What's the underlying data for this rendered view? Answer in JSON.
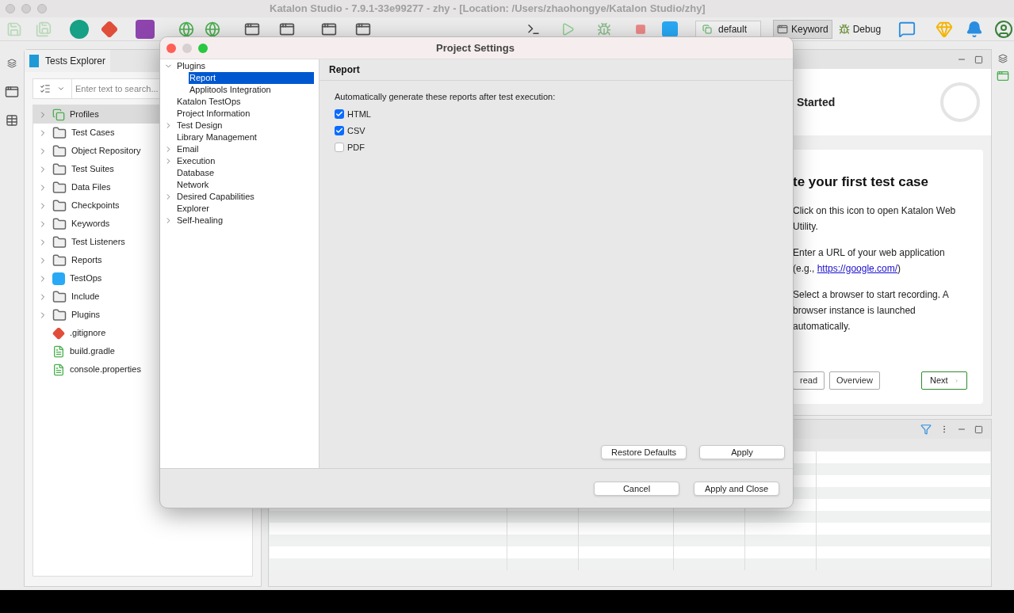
{
  "window": {
    "title": "Katalon Studio - 7.9.1-33e99277 - zhy - [Location: /Users/zhaohongye/Katalon Studio/zhy]"
  },
  "toolbar": {
    "profile": "default",
    "keyword_button": "Keyword",
    "debug_button": "Debug"
  },
  "explorer": {
    "tab": "Tests Explorer",
    "search_placeholder": "Enter text to search...",
    "items": [
      {
        "label": "Profiles",
        "kind": "profiles",
        "selected": true
      },
      {
        "label": "Test Cases",
        "kind": "folder",
        "selected": false
      },
      {
        "label": "Object Repository",
        "kind": "folder",
        "selected": false
      },
      {
        "label": "Test Suites",
        "kind": "folder",
        "selected": false
      },
      {
        "label": "Data Files",
        "kind": "folder",
        "selected": false
      },
      {
        "label": "Checkpoints",
        "kind": "folder",
        "selected": false
      },
      {
        "label": "Keywords",
        "kind": "folder",
        "selected": false
      },
      {
        "label": "Test Listeners",
        "kind": "folder",
        "selected": false
      },
      {
        "label": "Reports",
        "kind": "folder",
        "selected": false
      },
      {
        "label": "TestOps",
        "kind": "testops",
        "selected": false
      },
      {
        "label": "Include",
        "kind": "folder",
        "selected": false
      },
      {
        "label": "Plugins",
        "kind": "folder",
        "selected": false
      },
      {
        "label": ".gitignore",
        "kind": "git",
        "selected": false
      },
      {
        "label": "build.gradle",
        "kind": "file",
        "selected": false
      },
      {
        "label": "console.properties",
        "kind": "file",
        "selected": false
      }
    ]
  },
  "getting_started": {
    "title": "Started",
    "heading": "te your first test case",
    "paragraphs": [
      {
        "text": "Click on this icon  to open Katalon Web Utility."
      },
      {
        "text": "Enter a URL of your web application (e.g., ",
        "link": "https://google.com/",
        "after": ")"
      },
      {
        "text": "Select a browser to start recording. A browser instance is launched automatically."
      }
    ],
    "buttons": [
      "read",
      "Overview"
    ],
    "next_button": "Next"
  },
  "dialog": {
    "title": "Project Settings",
    "tree": [
      {
        "label": "Plugins",
        "expanded": true,
        "selected": false,
        "children": [
          {
            "label": "Report",
            "selected": true
          },
          {
            "label": "Applitools Integration",
            "selected": false
          }
        ]
      },
      {
        "label": "Katalon TestOps",
        "selected": false
      },
      {
        "label": "Project Information",
        "selected": false
      },
      {
        "label": "Test Design",
        "expanded": false,
        "selected": false
      },
      {
        "label": "Library Management",
        "selected": false
      },
      {
        "label": "Email",
        "expanded": false,
        "selected": false
      },
      {
        "label": "Execution",
        "expanded": false,
        "selected": false
      },
      {
        "label": "Database",
        "selected": false
      },
      {
        "label": "Network",
        "selected": false
      },
      {
        "label": "Desired Capabilities",
        "expanded": false,
        "selected": false
      },
      {
        "label": "Explorer",
        "selected": false
      },
      {
        "label": "Self-healing",
        "expanded": false,
        "selected": false
      }
    ],
    "page_title": "Report",
    "description": "Automatically generate these reports after test execution:",
    "options": [
      {
        "label": "HTML",
        "checked": true
      },
      {
        "label": "CSV",
        "checked": true
      },
      {
        "label": "PDF",
        "checked": false
      }
    ],
    "restore_defaults": "Restore Defaults",
    "apply": "Apply",
    "cancel": "Cancel",
    "apply_and_close": "Apply and Close"
  }
}
